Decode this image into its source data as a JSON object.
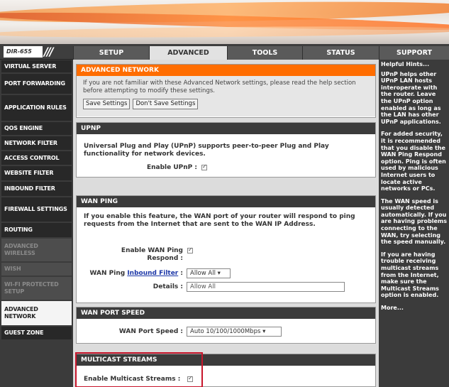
{
  "colors": {
    "accent_orange": "#ff6d00",
    "dark_panel": "#3b3b3b",
    "highlight_red": "#c7152b"
  },
  "header": {
    "model": "DIR-655",
    "divider": "///"
  },
  "tabs": [
    {
      "label": "SETUP",
      "active": false
    },
    {
      "label": "ADVANCED",
      "active": true
    },
    {
      "label": "TOOLS",
      "active": false
    },
    {
      "label": "STATUS",
      "active": false
    },
    {
      "label": "SUPPORT",
      "active": false
    }
  ],
  "sidebar": {
    "items": [
      {
        "label": "VIRTUAL SERVER",
        "state": "normal"
      },
      {
        "label": "PORT FORWARDING",
        "state": "normal"
      },
      {
        "label": "APPLICATION RULES",
        "state": "normal"
      },
      {
        "label": "QOS ENGINE",
        "state": "normal"
      },
      {
        "label": "NETWORK FILTER",
        "state": "normal"
      },
      {
        "label": "ACCESS CONTROL",
        "state": "normal"
      },
      {
        "label": "WEBSITE FILTER",
        "state": "normal"
      },
      {
        "label": "INBOUND FILTER",
        "state": "normal"
      },
      {
        "label": "FIREWALL SETTINGS",
        "state": "normal"
      },
      {
        "label": "ROUTING",
        "state": "normal"
      },
      {
        "label": "ADVANCED WIRELESS",
        "state": "disabled"
      },
      {
        "label": "WISH",
        "state": "disabled"
      },
      {
        "label": "WI-FI PROTECTED SETUP",
        "state": "disabled"
      },
      {
        "label": "ADVANCED NETWORK",
        "state": "current"
      },
      {
        "label": "GUEST ZONE",
        "state": "normal"
      }
    ]
  },
  "advanced_network": {
    "title": "ADVANCED NETWORK",
    "intro": "If you are not familiar with these Advanced Network settings, please read the help section before attempting to modify these settings.",
    "save_label": "Save Settings",
    "dont_save_label": "Don't Save Settings"
  },
  "upnp": {
    "title": "UPNP",
    "description": "Universal Plug and Play (UPnP) supports peer-to-peer Plug and Play functionality for network devices.",
    "enable_label": "Enable UPnP :",
    "enabled": true
  },
  "wan_ping": {
    "title": "WAN PING",
    "description": "If you enable this feature, the WAN port of your router will respond to ping requests from the Internet that are sent to the WAN IP Address.",
    "enable_label_line1": "Enable WAN Ping",
    "enable_label_line2": "Respond :",
    "enabled": true,
    "filter_label_prefix": "WAN Ping",
    "filter_link": "Inbound Filter",
    "filter_label_suffix": ":",
    "filter_value": "Allow All",
    "details_label": "Details :",
    "details_value": "Allow All"
  },
  "wan_port_speed": {
    "title": "WAN PORT SPEED",
    "label": "WAN Port Speed :",
    "value": "Auto 10/100/1000Mbps"
  },
  "multicast": {
    "title": "MULTICAST STREAMS",
    "enable_label": "Enable Multicast Streams :",
    "enabled": true
  },
  "hints": {
    "title": "Helpful Hints...",
    "items": [
      "UPnP helps other UPnP LAN hosts interoperate with the router. Leave the UPnP option enabled as long as the LAN has other UPnP applications.",
      "For added security, it is recommended that you disable the WAN Ping Respond option. Ping is often used by malicious Internet users to locate active networks or PCs.",
      "The WAN speed is usually detected automatically. If you are having problems connecting to the WAN, try selecting the speed manually.",
      "If you are having trouble receiving multicast streams from the Internet, make sure the Multicast Streams option is enabled."
    ],
    "more": "More..."
  }
}
